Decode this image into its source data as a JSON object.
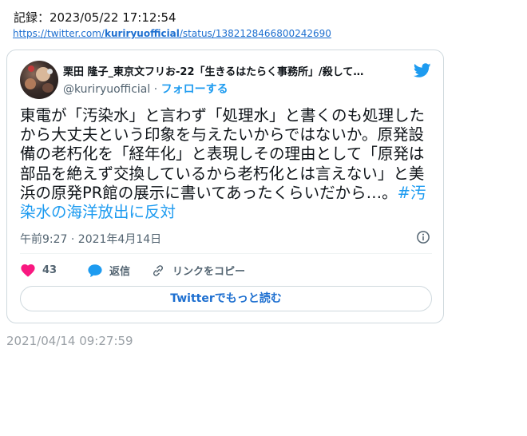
{
  "record": {
    "label": "記録：2023/05/22 17:12:54"
  },
  "source": {
    "prefix": "https://twitter.com/",
    "user": "kuriryuofficial",
    "suffix": "/status/1382128466800242690"
  },
  "tweet": {
    "display_name": "栗田 隆子_東京文フリお-22「生きるはたらく事務所」/殺して…",
    "handle": "@kuriryuofficial",
    "separator": "·",
    "follow_label": "フォローする",
    "text": "東電が「汚染水」と言わず「処理水」と書くのも処理したから大丈夫という印象を与えたいからではないか。原発設備の老朽化を「経年化」と表現しその理由として「原発は部品を絶えず交換しているから老朽化とは言えない」と美浜の原発PR館の展示に書いてあったくらいだから…。",
    "hashtag": "#汚染水の海洋放出に反対",
    "timestamp": "午前9:27 · 2021年4月14日",
    "likes": "43",
    "reply_label": "返信",
    "copy_link_label": "リンクをコピー",
    "read_more_label": "Twitterでもっと読む"
  },
  "archived_date": "2021/04/14 09:27:59",
  "colors": {
    "twitter_blue": "#1d9bf0",
    "like_pink": "#f91880"
  },
  "icons": [
    "twitter-bird-icon",
    "info-icon",
    "heart-icon",
    "reply-bubble-icon",
    "link-icon"
  ]
}
